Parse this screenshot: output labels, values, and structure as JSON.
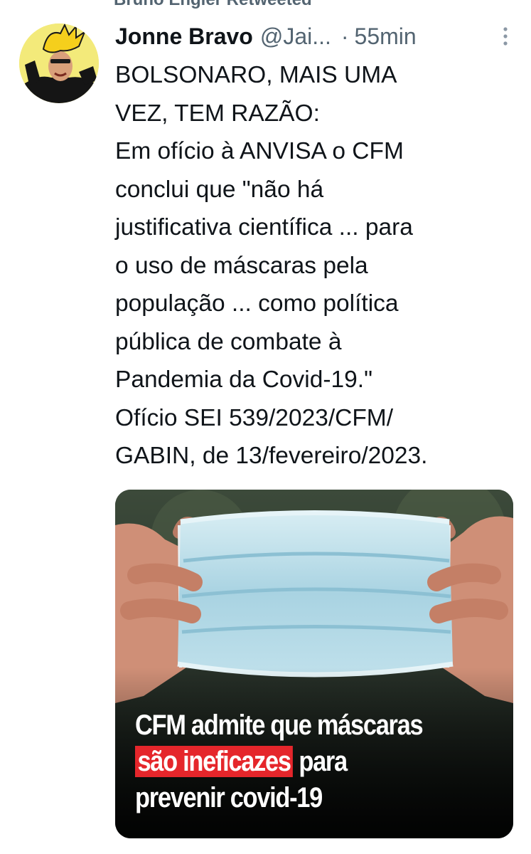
{
  "retweet": {
    "label": "Bruno Engler Retweeted"
  },
  "tweet": {
    "author_name": "Jonne Bravo",
    "author_handle": "@Jai...",
    "separator": "·",
    "time": "55min",
    "lines": [
      "BOLSONARO, MAIS UMA",
      "VEZ, TEM RAZÃO:",
      "Em ofício à ANVISA o CFM",
      "conclui que \"não há",
      "justificativa científica ... para",
      "o uso de máscaras pela",
      "população ... como política",
      "pública de combate à",
      "Pandemia da Covid-19.\"",
      "Ofício SEI 539/2023/CFM/",
      "GABIN, de 13/fevereiro/2023."
    ]
  },
  "media": {
    "headline_line1": "CFM admite que máscaras",
    "headline_highlight": "são ineficazes",
    "headline_line2_rest": " para",
    "headline_line3": "prevenir covid-19",
    "highlight_color": "#e5262b"
  },
  "colors": {
    "text": "#0f1419",
    "secondary": "#536471",
    "background": "#ffffff"
  },
  "icons": {
    "more": "more-vertical-icon"
  }
}
